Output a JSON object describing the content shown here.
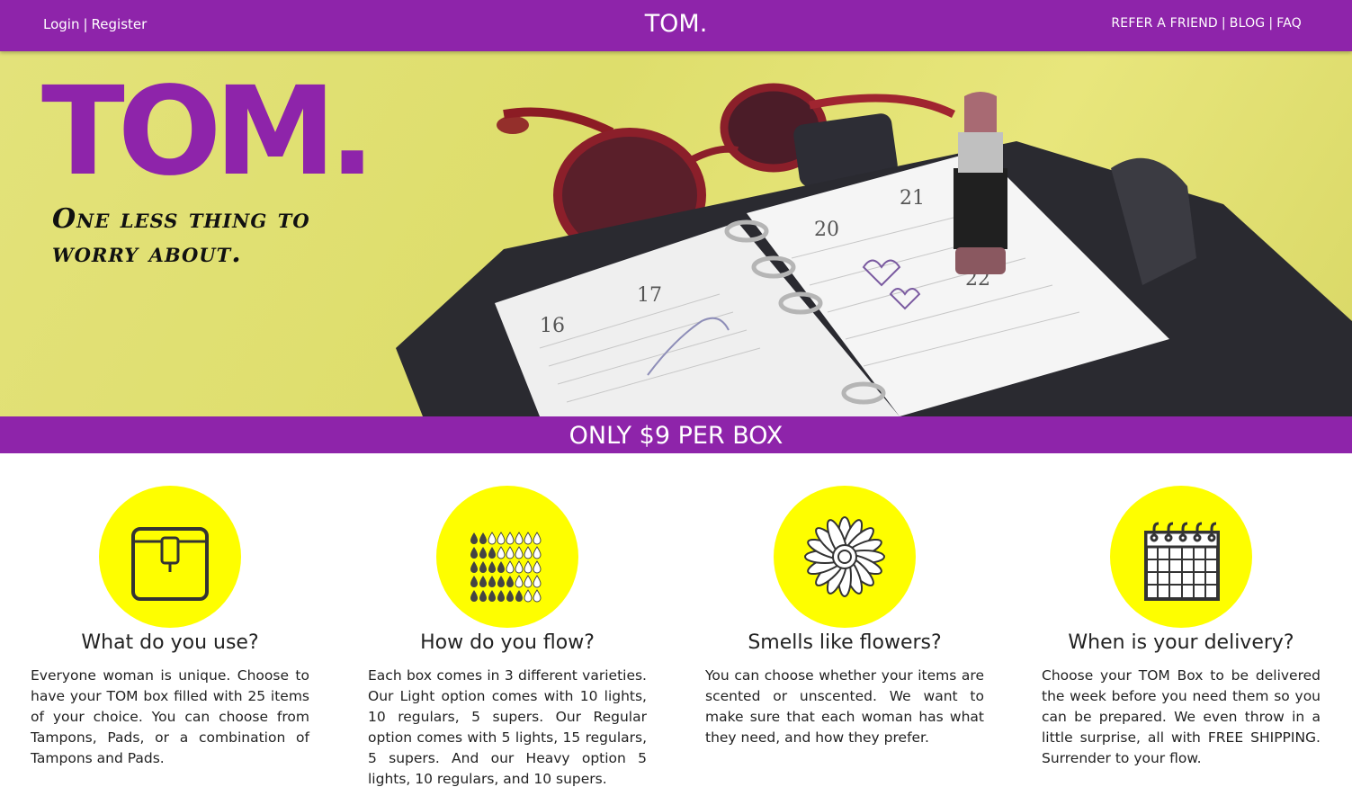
{
  "nav": {
    "login": "Login",
    "register": "Register",
    "separator": "|",
    "brand": "TOM.",
    "refer": "REFER A FRIEND",
    "blog": "BLOG",
    "faq": "FAQ"
  },
  "hero": {
    "logo": "TOM.",
    "tagline": "One less thing to worry about."
  },
  "price": "ONLY $9 PER BOX",
  "features": [
    {
      "icon": "pouch-icon",
      "title": "What do you use?",
      "text": "Everyone woman is unique. Choose to have your TOM box filled with 25 items of your choice. You can choose from Tampons, Pads, or a combination of Tampons and Pads."
    },
    {
      "icon": "droplets-icon",
      "title": "How do you flow?",
      "text": "Each box comes in 3 different varieties. Our Light option comes with 10 lights, 10 regulars, 5 supers. Our Regular option comes with 5 lights, 15 regulars, 5 supers. And our Heavy option 5 lights, 10 regulars, and 10 supers."
    },
    {
      "icon": "flower-icon",
      "title": "Smells like flowers?",
      "text": "You can choose whether your items are scented or unscented. We want to make sure that each woman has what they need, and how they prefer."
    },
    {
      "icon": "calendar-icon",
      "title": "When is your delivery?",
      "text": "Choose your TOM Box to be delivered the week before you need them so you can be prepared. We even throw in a little surprise, all with FREE SHIPPING. Surrender to your flow."
    }
  ],
  "colors": {
    "brand": "#8e24aa",
    "accent": "#fefe00",
    "hero_bg": "#e2e07a"
  }
}
